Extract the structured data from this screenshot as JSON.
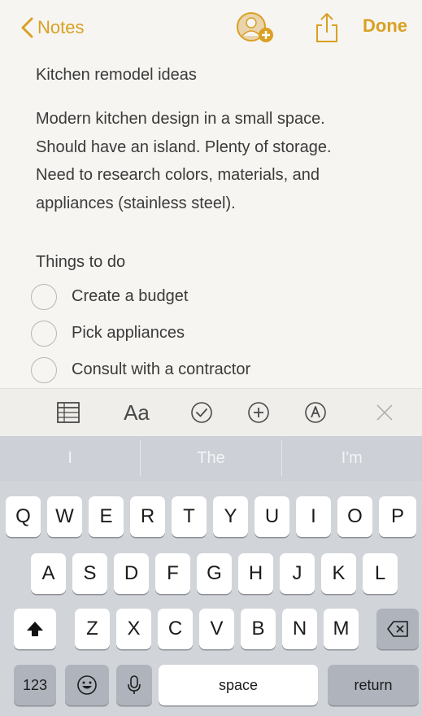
{
  "nav": {
    "back_label": "Notes",
    "done_label": "Done",
    "accent_color": "#d9a023"
  },
  "note": {
    "title": "Kitchen remodel ideas",
    "body_lines": [
      "Modern kitchen design in a small space.",
      "Should have an island. Plenty of storage.",
      "Need to research colors, materials, and",
      "appliances (stainless steel)."
    ],
    "checklist_heading": "Things to do",
    "checklist": [
      {
        "text": "Create a budget",
        "checked": false
      },
      {
        "text": "Pick appliances",
        "checked": false
      },
      {
        "text": "Consult with a contractor",
        "checked": false
      }
    ]
  },
  "format_toolbar": {
    "items": [
      "table-icon",
      "text-style-aa",
      "checklist-icon",
      "add-icon",
      "markup-pen-icon",
      "close-icon"
    ],
    "text_style_label": "Aa"
  },
  "predictions": [
    "I",
    "The",
    "I'm"
  ],
  "keyboard": {
    "row1": [
      "Q",
      "W",
      "E",
      "R",
      "T",
      "Y",
      "U",
      "I",
      "O",
      "P"
    ],
    "row2": [
      "A",
      "S",
      "D",
      "F",
      "G",
      "H",
      "J",
      "K",
      "L"
    ],
    "row3": [
      "Z",
      "X",
      "C",
      "V",
      "B",
      "N",
      "M"
    ],
    "numbers_label": "123",
    "space_label": "space",
    "return_label": "return",
    "icons": [
      "shift-icon",
      "backspace-icon",
      "emoji-icon",
      "microphone-icon"
    ]
  }
}
